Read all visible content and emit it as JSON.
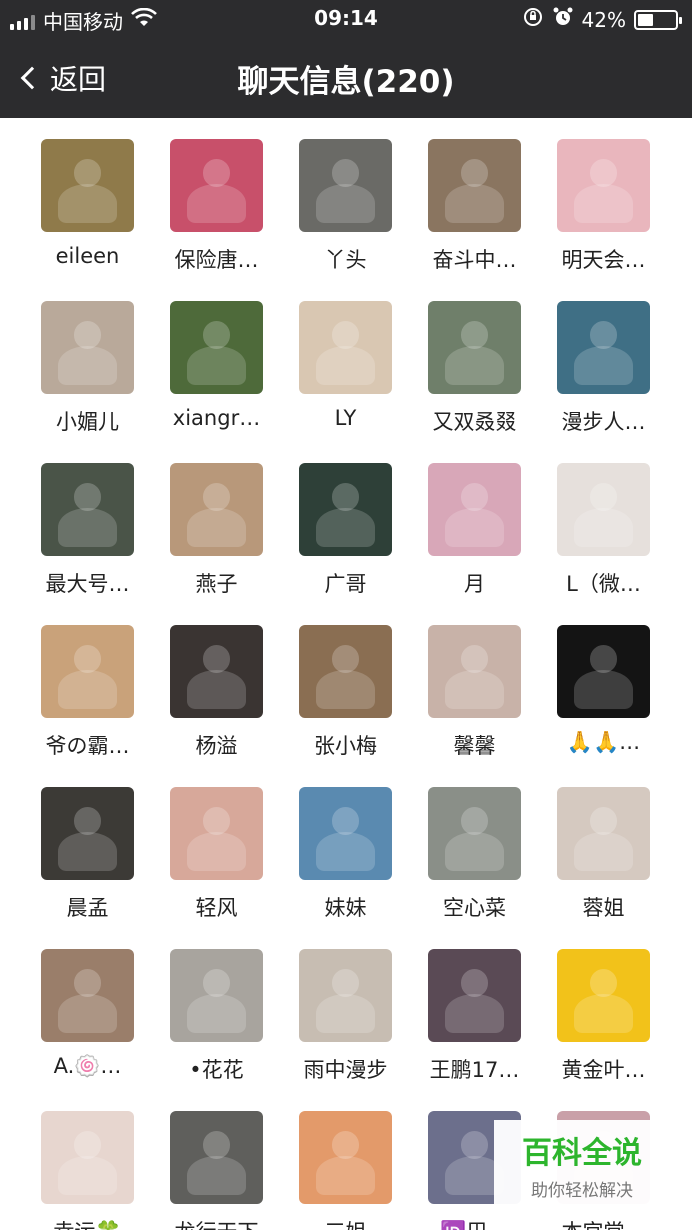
{
  "status_bar": {
    "carrier": "中国移动",
    "time": "09:14",
    "battery": "42%",
    "battery_level": 0.42
  },
  "nav": {
    "back_label": "返回",
    "title": "聊天信息(220)"
  },
  "members": [
    {
      "name": "eileen",
      "color": "#8f7a4a"
    },
    {
      "name": "保险唐…",
      "color": "#c8506a"
    },
    {
      "name": "丫头",
      "color": "#6a6a66"
    },
    {
      "name": "奋斗中…",
      "color": "#8a7560"
    },
    {
      "name": "明天会…",
      "color": "#e9b6bd"
    },
    {
      "name": "小媚儿",
      "color": "#b9a99a"
    },
    {
      "name": "xiangr…",
      "color": "#4e6a3a"
    },
    {
      "name": "LY",
      "color": "#d9c7b2"
    },
    {
      "name": "又双叒叕",
      "color": "#6f7f6a"
    },
    {
      "name": "漫步人…",
      "color": "#3f6f85"
    },
    {
      "name": "最大号…",
      "color": "#4a5448"
    },
    {
      "name": "燕子",
      "color": "#b8987a"
    },
    {
      "name": "广哥",
      "color": "#2e4038"
    },
    {
      "name": "月",
      "color": "#d8a7b8"
    },
    {
      "name": "L（微…",
      "color": "#e6e0dc"
    },
    {
      "name": "爷の霸…",
      "color": "#c9a27a"
    },
    {
      "name": "杨溢",
      "color": "#3a3432"
    },
    {
      "name": "张小梅",
      "color": "#8a6e52"
    },
    {
      "name": "馨馨",
      "color": "#c8b2a8"
    },
    {
      "name": "🙏🙏…",
      "color": "#141414"
    },
    {
      "name": "晨孟",
      "color": "#3c3a36"
    },
    {
      "name": "轻风",
      "color": "#d7a89a"
    },
    {
      "name": "妹妹",
      "color": "#5a8ab0"
    },
    {
      "name": "空心菜",
      "color": "#8a8f88"
    },
    {
      "name": "蓉姐",
      "color": "#d5c9c0"
    },
    {
      "name": "A.🍥…",
      "color": "#9a7e6a"
    },
    {
      "name": "•花花",
      "color": "#a8a49e"
    },
    {
      "name": "雨中漫步",
      "color": "#c7bdb2"
    },
    {
      "name": "王鹏17…",
      "color": "#5a4a55"
    },
    {
      "name": "黄金叶…",
      "color": "#f2c21a"
    },
    {
      "name": "幸运🍀",
      "color": "#e7d6cf"
    },
    {
      "name": "龙行天下",
      "color": "#5f5f5c"
    },
    {
      "name": "三姐",
      "color": "#e39a6a"
    },
    {
      "name": "🆔巴…",
      "color": "#6c6f8c"
    },
    {
      "name": "本宫堂…",
      "color": "#c9a0a8"
    }
  ],
  "watermark": {
    "main": "百科全说",
    "sub": "助你轻松解决"
  }
}
